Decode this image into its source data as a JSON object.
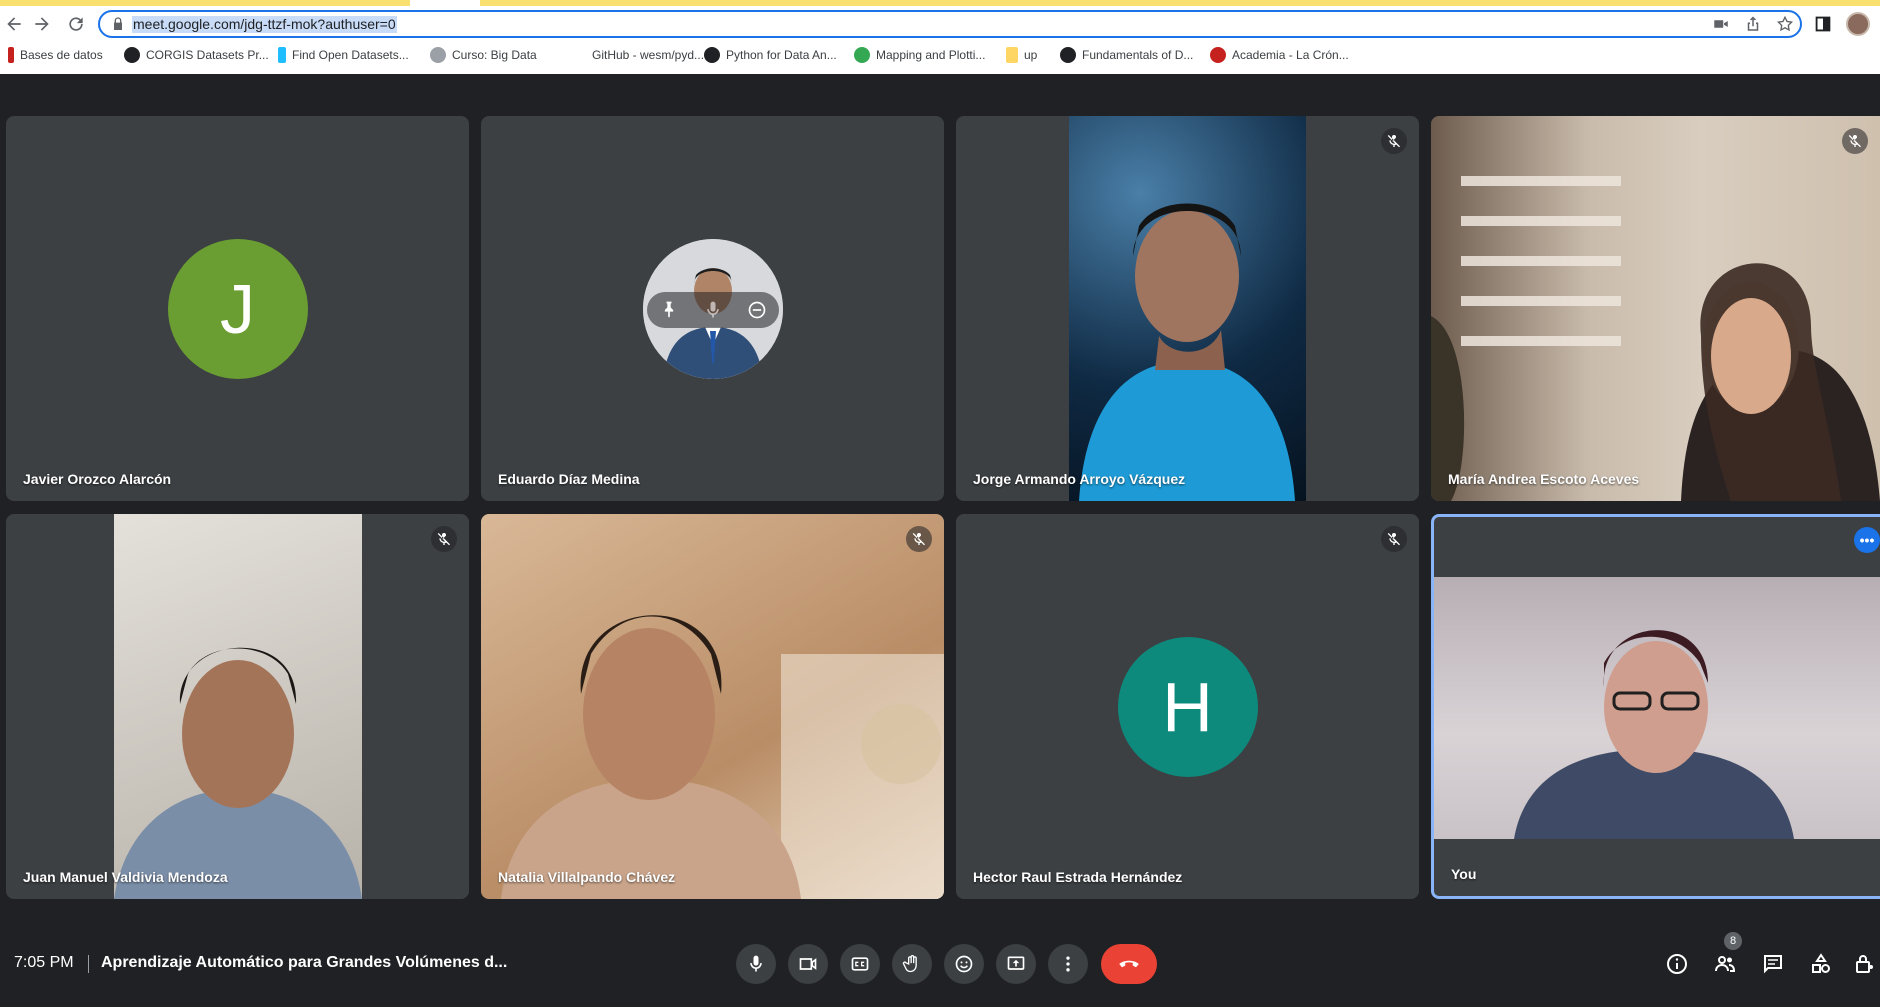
{
  "browser": {
    "url": "meet.google.com/jdg-ttzf-mok?authuser=0",
    "bookmarks": [
      {
        "label": "Bases de datos",
        "color": "#c5221f"
      },
      {
        "label": "CORGIS Datasets Pr...",
        "color": "#202124"
      },
      {
        "label": "Find Open Datasets...",
        "color": "#20beff"
      },
      {
        "label": "Curso: Big Data",
        "color": "#9aa0a6"
      },
      {
        "label": "GitHub - wesm/pyd...",
        "color": "#ffffff"
      },
      {
        "label": "Python for Data An...",
        "color": "#202124"
      },
      {
        "label": "Mapping and Plotti...",
        "color": "#34a853"
      },
      {
        "label": "up",
        "color": "#fdd663"
      },
      {
        "label": "Fundamentals of D...",
        "color": "#202124"
      },
      {
        "label": "Academia - La Crón...",
        "color": "#c5221f"
      }
    ]
  },
  "participants": [
    {
      "name": "Javier Orozco Alarcón",
      "type": "avatar",
      "initial": "J",
      "color": "#6b9e32",
      "muted": false
    },
    {
      "name": "Eduardo Díaz Medina",
      "type": "photo-avatar",
      "muted": false
    },
    {
      "name": "Jorge Armando Arroyo Vázquez",
      "type": "video",
      "muted": true
    },
    {
      "name": "María Andrea Escoto Aceves",
      "type": "video",
      "muted": true
    },
    {
      "name": "Juan Manuel Valdivia Mendoza",
      "type": "video",
      "muted": true
    },
    {
      "name": "Natalia Villalpando Chávez",
      "type": "video",
      "muted": true
    },
    {
      "name": "Hector Raul Estrada Hernández",
      "type": "avatar",
      "initial": "H",
      "color": "#0e8a7d",
      "muted": true
    },
    {
      "name": "You",
      "type": "video",
      "muted": false
    }
  ],
  "bottom_bar": {
    "time": "7:05 PM",
    "meeting_title": "Aprendizaje Automático para Grandes Volúmenes d...",
    "participant_count": "8",
    "leave_color": "#ea4335"
  }
}
